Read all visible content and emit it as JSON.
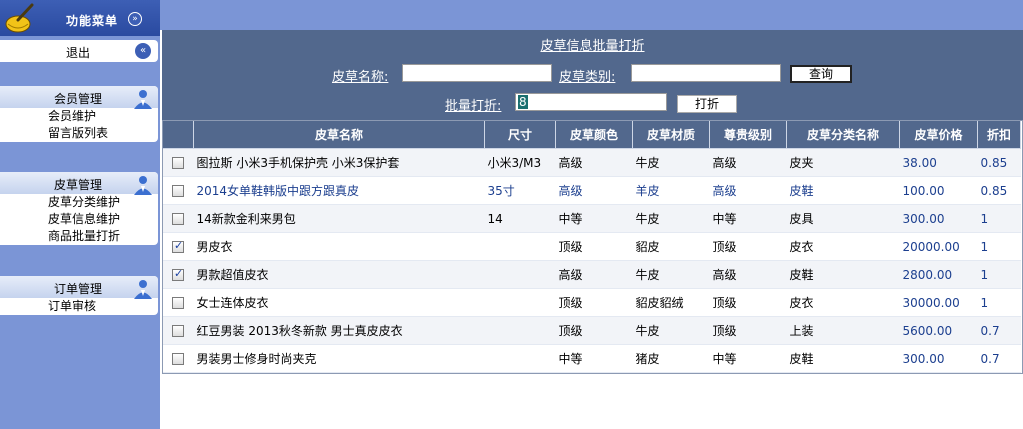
{
  "sidebar": {
    "title": "功能菜单",
    "logout_label": "退出",
    "groups": [
      {
        "label": "会员管理",
        "items": [
          "会员维护",
          "留言版列表"
        ]
      },
      {
        "label": "皮草管理",
        "items": [
          "皮草分类维护",
          "皮草信息维护",
          "商品批量打折"
        ]
      },
      {
        "label": "订单管理",
        "items": [
          "订单审核"
        ]
      }
    ]
  },
  "form": {
    "title": "皮草信息批量打折",
    "name_label": "皮草名称:",
    "name_value": "",
    "category_label": "皮草类别:",
    "category_value": "",
    "search_button": "查询",
    "discount_label": "批量打折:",
    "discount_value": "8",
    "discount_button": "打折"
  },
  "table": {
    "headers": [
      "皮草名称",
      "尺寸",
      "皮草颜色",
      "皮草材质",
      "尊贵级别",
      "皮草分类名称",
      "皮草价格",
      "折扣"
    ],
    "rows": [
      {
        "checked": false,
        "name": "图拉斯 小米3手机保护壳 小米3保护套",
        "size": "小米3/M3",
        "color": "高级",
        "material": "牛皮",
        "level": "高级",
        "category": "皮夹",
        "price": "38.00",
        "discount": "0.85"
      },
      {
        "checked": false,
        "name": "2014女单鞋韩版中跟方跟真皮",
        "size": "35寸",
        "color": "高级",
        "material": "羊皮",
        "level": "高级",
        "category": "皮鞋",
        "price": "100.00",
        "discount": "0.85"
      },
      {
        "checked": false,
        "name": "14新款金利来男包",
        "size": "14",
        "color": "中等",
        "material": "牛皮",
        "level": "中等",
        "category": "皮具",
        "price": "300.00",
        "discount": "1"
      },
      {
        "checked": true,
        "name": "男皮衣",
        "size": "",
        "color": "顶级",
        "material": "貂皮",
        "level": "顶级",
        "category": "皮衣",
        "price": "20000.00",
        "discount": "1"
      },
      {
        "checked": true,
        "name": "男款超值皮衣",
        "size": "",
        "color": "高级",
        "material": "牛皮",
        "level": "高级",
        "category": "皮鞋",
        "price": "2800.00",
        "discount": "1"
      },
      {
        "checked": false,
        "name": "女士连体皮衣",
        "size": "",
        "color": "顶级",
        "material": "貂皮貂绒",
        "level": "顶级",
        "category": "皮衣",
        "price": "30000.00",
        "discount": "1"
      },
      {
        "checked": false,
        "name": "红豆男装 2013秋冬新款 男士真皮皮衣",
        "size": "",
        "color": "顶级",
        "material": "牛皮",
        "level": "顶级",
        "category": "上装",
        "price": "5600.00",
        "discount": "0.7"
      },
      {
        "checked": false,
        "name": "男装男士修身时尚夹克",
        "size": "",
        "color": "中等",
        "material": "猪皮",
        "level": "中等",
        "category": "皮鞋",
        "price": "300.00",
        "discount": "0.7"
      }
    ]
  },
  "icons": {
    "menu_logo": "broom-icon",
    "collapse": "double-chevron-down-icon",
    "logout": "double-chevron-left-icon",
    "group": "person-icon"
  },
  "colors": {
    "sidebar_bg": "#7b95d6",
    "header_bg": "#52688d",
    "text_blue": "#1c3f8f"
  }
}
